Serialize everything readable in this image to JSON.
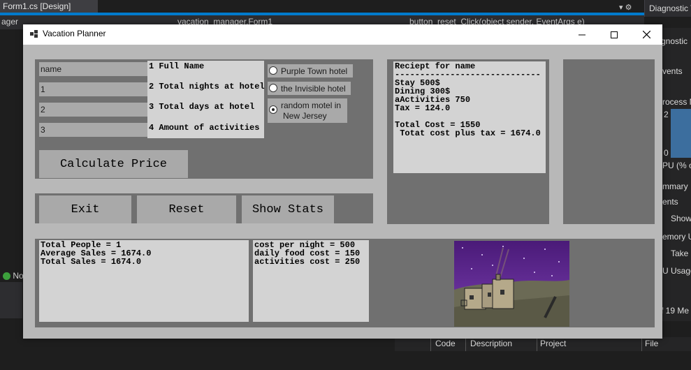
{
  "ide": {
    "designer_tab": "Form1.cs [Design]",
    "left_combo": "ager",
    "mid_combo": "vacation_manager.Form1",
    "right_combo": "button_reset_Click(object sender, EventArgs e)",
    "diagnostic_title": "Diagnostic T",
    "right_items": [
      "gnostic",
      "vents",
      "rocess M",
      "2",
      "0",
      "PU (% o",
      "mmary",
      "ents",
      "Show",
      "emory U",
      "Take S",
      "U Usage",
      "f 19 Me"
    ],
    "left_status": "No",
    "error_cols": [
      "Code",
      "Description",
      "Project",
      "File"
    ]
  },
  "window": {
    "title": "Vacation Planner"
  },
  "inputs": {
    "name": "name",
    "nights": "1",
    "days": "2",
    "activities": "3"
  },
  "labels": {
    "full_name": "1 Full Name",
    "nights": "2 Total nights at hotel",
    "days": "3 Total days at hotel",
    "activities": "4 Amount of activities"
  },
  "hotels": {
    "opt1": "Purple Town hotel",
    "opt2": "the Invisible hotel",
    "opt3_line1": "random motel in",
    "opt3_line2": "New Jersey",
    "selected": "opt3"
  },
  "buttons": {
    "calculate": "Calculate Price",
    "exit": "Exit",
    "reset": "Reset",
    "stats": "Show Stats"
  },
  "receipt": {
    "lines": [
      "Reciept for name",
      "-----------------------------",
      "Stay 500$",
      "Dining 300$",
      "aActivities 750",
      "Tax = 124.0",
      "",
      "Total Cost = 1550",
      " Totat cost plus tax = 1674.0"
    ]
  },
  "stats": {
    "lines": [
      "Total People = 1",
      "Average Sales = 1674.0",
      "Total Sales = 1674.0"
    ]
  },
  "costs": {
    "lines": [
      "cost per night = 500",
      "daily food cost = 150",
      "activities cost = 250"
    ]
  }
}
